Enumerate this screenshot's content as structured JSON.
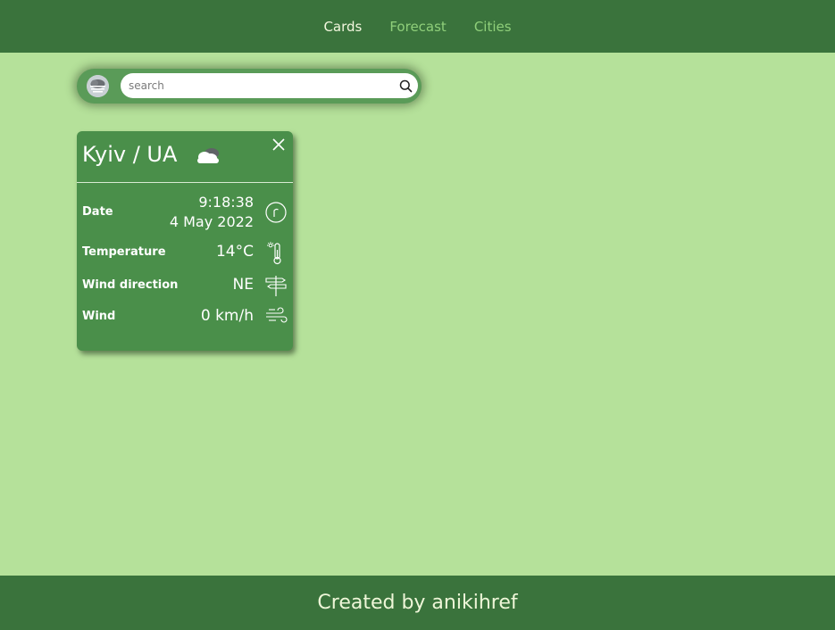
{
  "nav": {
    "items": [
      {
        "label": "Cards",
        "active": true
      },
      {
        "label": "Forecast",
        "active": false
      },
      {
        "label": "Cities",
        "active": false
      }
    ]
  },
  "search": {
    "placeholder": "search",
    "value": "",
    "logo_icon": "weather-app-logo-icon",
    "button_icon": "search-icon"
  },
  "card": {
    "city": "Kyiv / UA",
    "weather_icon": "cloud-icon",
    "close_icon": "close-icon",
    "rows": {
      "date": {
        "label": "Date",
        "time": "9:18:38",
        "date": "4 May 2022",
        "icon": "clock-icon"
      },
      "temperature": {
        "label": "Temperature",
        "value": "14°C",
        "icon": "thermometer-icon"
      },
      "wind_direction": {
        "label": "Wind direction",
        "value": "NE",
        "icon": "signpost-icon"
      },
      "wind": {
        "label": "Wind",
        "value": "0 km/h",
        "icon": "wind-icon"
      }
    }
  },
  "footer": {
    "text": "Created by anikihref"
  },
  "colors": {
    "background": "#b5e19a",
    "header": "#3a733c",
    "card": "#4a8f4a",
    "nav_active": "#f2f7de",
    "nav_inactive": "#8fcf7a"
  }
}
